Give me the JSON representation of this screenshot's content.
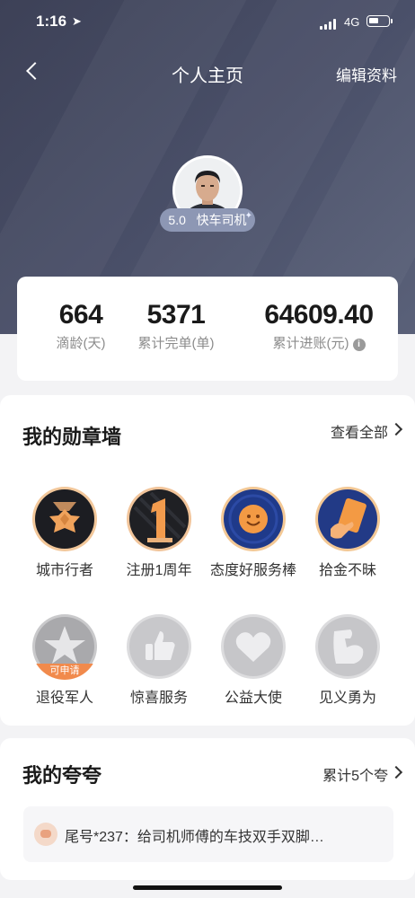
{
  "status": {
    "time": "1:16",
    "network": "4G"
  },
  "nav": {
    "title": "个人主页",
    "edit": "编辑资料"
  },
  "profile": {
    "rating": "5.0",
    "role": "快车司机"
  },
  "stats": [
    {
      "value": "664",
      "label": "滴龄(天)"
    },
    {
      "value": "5371",
      "label": "累计完单(单)"
    },
    {
      "value": "64609.40",
      "label": "累计进账(元)"
    }
  ],
  "medals": {
    "title": "我的勋章墙",
    "more": "查看全部",
    "items": [
      {
        "label": "城市行者",
        "icon": "city-walker-medal-icon"
      },
      {
        "label": "注册1周年",
        "icon": "first-anniversary-medal-icon"
      },
      {
        "label": "态度好服务棒",
        "icon": "smile-service-medal-icon"
      },
      {
        "label": "拾金不昧",
        "icon": "honesty-medal-icon"
      },
      {
        "label": "退役军人",
        "icon": "veteran-star-medal-icon",
        "tag": "可申请"
      },
      {
        "label": "惊喜服务",
        "icon": "thumbs-up-medal-icon"
      },
      {
        "label": "公益大使",
        "icon": "heart-medal-icon"
      },
      {
        "label": "见义勇为",
        "icon": "muscle-medal-icon"
      }
    ]
  },
  "praise": {
    "title": "我的夸夸",
    "more": "累计5个夸",
    "items": [
      {
        "text": "尾号*237：给司机师傅的车技双手双脚…"
      }
    ]
  }
}
